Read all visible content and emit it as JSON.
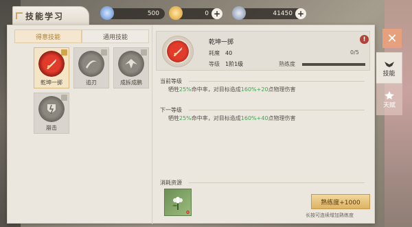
{
  "header": {
    "title": "技能学习",
    "resources": [
      {
        "icon": "diamond-icon",
        "value": "500",
        "has_plus": false
      },
      {
        "icon": "gold-coin-icon",
        "value": "0",
        "has_plus": true
      },
      {
        "icon": "silver-coin-icon",
        "value": "41450",
        "has_plus": true
      }
    ]
  },
  "sub_tabs": [
    {
      "label": "得意技能",
      "active": true
    },
    {
      "label": "通用技能",
      "active": false
    }
  ],
  "skills": [
    {
      "name": "乾坤一掷",
      "icon": "thrown-blade-skill-icon",
      "selected": true
    },
    {
      "name": "追刃",
      "icon": "chasing-blade-skill-icon",
      "selected": false
    },
    {
      "name": "成拆成鹏",
      "icon": "roc-strike-skill-icon",
      "selected": false
    },
    {
      "name": "崩击",
      "icon": "shield-break-skill-icon",
      "selected": false
    }
  ],
  "detail": {
    "name": "乾坤一掷",
    "cost_label": "耗魔",
    "cost_value": "40",
    "level_label": "等级",
    "level_value": "1阶1级",
    "proficiency_label": "熟练度",
    "proficiency_value": "0/5",
    "proficiency_fraction": 0
  },
  "current_level": {
    "title": "当前等级",
    "parts": [
      {
        "text": "牺牲",
        "green": false
      },
      {
        "text": "25%",
        "green": true
      },
      {
        "text": "命中率，对目标造成",
        "green": false
      },
      {
        "text": "160%+20",
        "green": true
      },
      {
        "text": "点物理伤害",
        "green": false
      }
    ]
  },
  "next_level": {
    "title": "下一等级",
    "parts": [
      {
        "text": "牺牲",
        "green": false
      },
      {
        "text": "25%",
        "green": true
      },
      {
        "text": "命中率，对目标造成",
        "green": false
      },
      {
        "text": "160%+40",
        "green": true
      },
      {
        "text": "点物理伤害",
        "green": false
      }
    ]
  },
  "cost": {
    "title": "消耗资源",
    "item_icon": "herb-flower-icon",
    "item_count": "0",
    "button_label": "熟练度+1000",
    "hint": "长按可连续增加熟练度"
  },
  "side_tabs": [
    {
      "label": "技能",
      "icon": "bird-crest-icon",
      "active": true
    },
    {
      "label": "天赋",
      "icon": "talent-crest-icon",
      "active": false
    }
  ],
  "colors": {
    "accent_gold": "#d3a54b",
    "green_text": "#3da54f",
    "close_orange": "#e6a07e"
  }
}
